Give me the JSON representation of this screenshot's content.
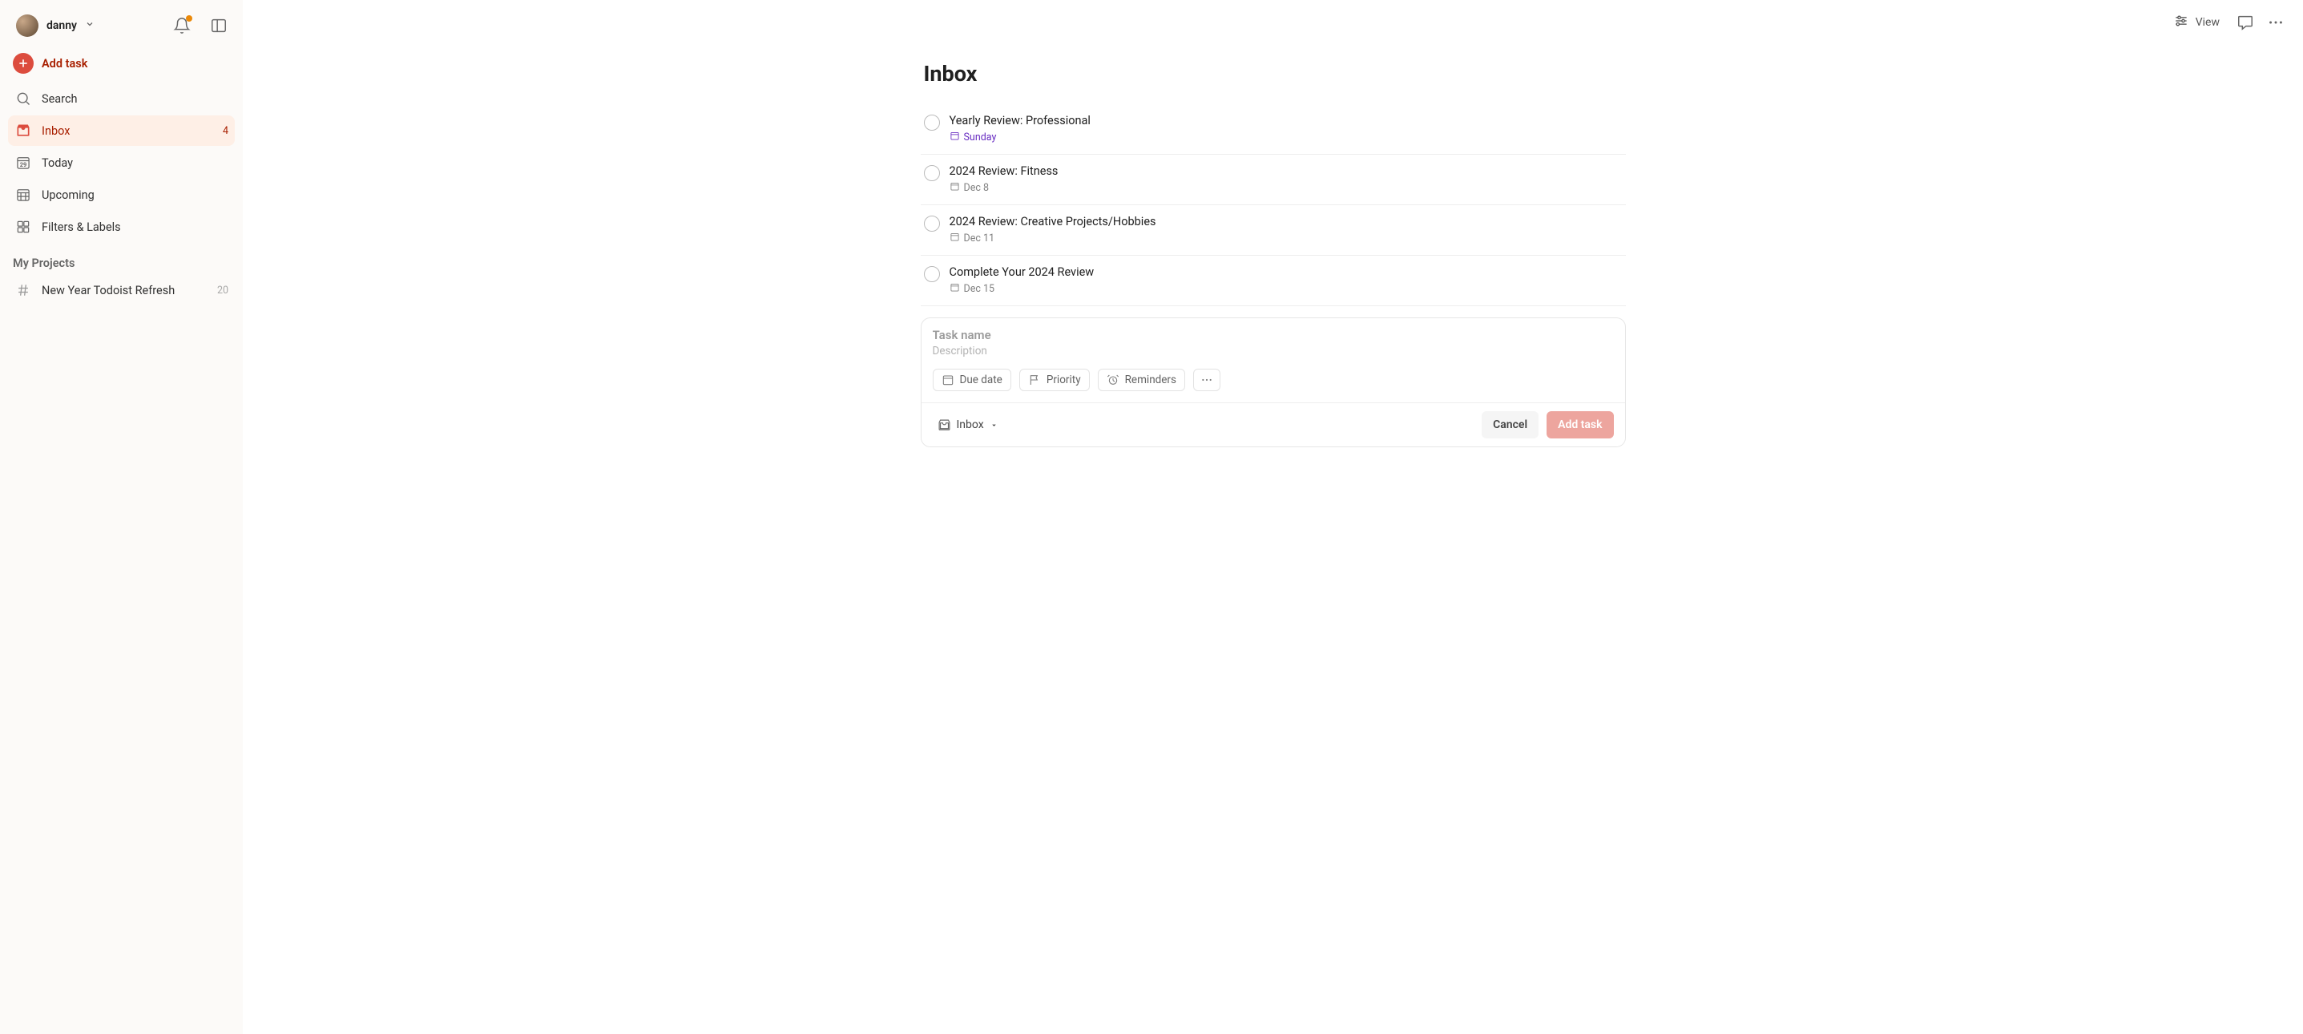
{
  "user": {
    "name": "danny"
  },
  "sidebar": {
    "add_task": "Add task",
    "nav": {
      "search": "Search",
      "inbox": {
        "label": "Inbox",
        "count": "4"
      },
      "today": {
        "label": "Today",
        "daynum": "29"
      },
      "upcoming": "Upcoming",
      "filters": "Filters & Labels"
    },
    "projects_header": "My Projects",
    "projects": [
      {
        "label": "New Year Todoist Refresh",
        "count": "20"
      }
    ]
  },
  "topbar": {
    "view": "View"
  },
  "page": {
    "title": "Inbox"
  },
  "tasks": [
    {
      "title": "Yearly Review: Professional",
      "date": "Sunday",
      "date_style": "purple"
    },
    {
      "title": "2024 Review: Fitness",
      "date": "Dec 8",
      "date_style": "grey"
    },
    {
      "title": "2024 Review: Creative Projects/Hobbies",
      "date": "Dec 11",
      "date_style": "grey"
    },
    {
      "title": "Complete Your 2024 Review",
      "date": "Dec 15",
      "date_style": "grey"
    }
  ],
  "editor": {
    "task_name_placeholder": "Task name",
    "description_placeholder": "Description",
    "chips": {
      "due_date": "Due date",
      "priority": "Priority",
      "reminders": "Reminders"
    },
    "project": "Inbox",
    "cancel": "Cancel",
    "add": "Add task"
  }
}
